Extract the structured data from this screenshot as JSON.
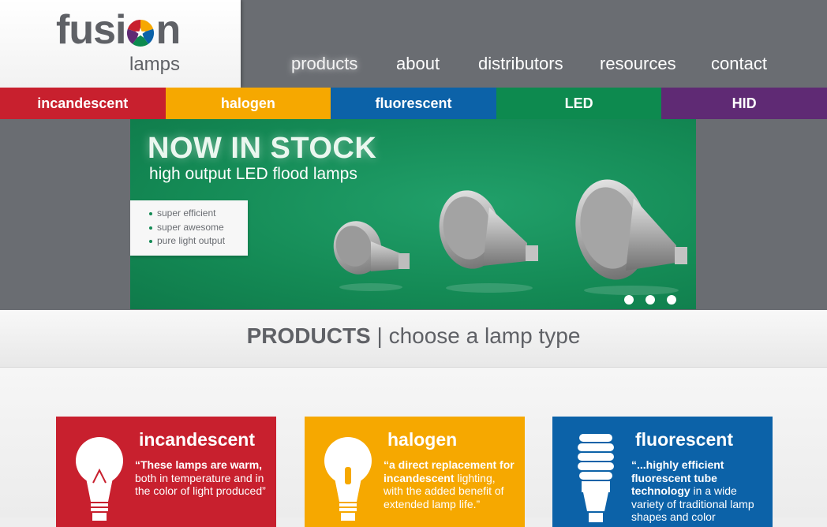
{
  "logo": {
    "word_left": "fusi",
    "word_right": "n",
    "sub": "lamps"
  },
  "nav": [
    {
      "label": "products"
    },
    {
      "label": "about"
    },
    {
      "label": "distributors"
    },
    {
      "label": "resources"
    },
    {
      "label": "contact"
    }
  ],
  "categories": [
    {
      "label": "incandescent",
      "color": "#c8202e"
    },
    {
      "label": "halogen",
      "color": "#f6a800"
    },
    {
      "label": "fluorescent",
      "color": "#0c62a8"
    },
    {
      "label": "LED",
      "color": "#0d8a4f"
    },
    {
      "label": "HID",
      "color": "#5f2a74"
    }
  ],
  "hero": {
    "title": "NOW IN STOCK",
    "subtitle": "high output LED flood lamps",
    "bullets": [
      "super efficient",
      "super awesome",
      "pure light output"
    ],
    "slide_count": 3
  },
  "section": {
    "bold": "PRODUCTS",
    "separator": " | ",
    "rest": "choose a lamp type"
  },
  "cards": [
    {
      "title": "incandescent",
      "color": "#c8202e",
      "icon": "incandescent-bulb-icon",
      "desc_bold": "“These lamps are warm,",
      "desc_rest": " both in temperature and in the color of light produced”"
    },
    {
      "title": "halogen",
      "color": "#f6a800",
      "icon": "halogen-bulb-icon",
      "desc_bold": "“a direct replacement for incandescent",
      "desc_rest": " lighting, with the added benefit of extended lamp life.”"
    },
    {
      "title": "fluorescent",
      "color": "#0c62a8",
      "icon": "cfl-bulb-icon",
      "desc_bold": "“...highly efficient fluorescent tube technology",
      "desc_rest": " in a wide variety of traditional lamp shapes and color"
    }
  ]
}
